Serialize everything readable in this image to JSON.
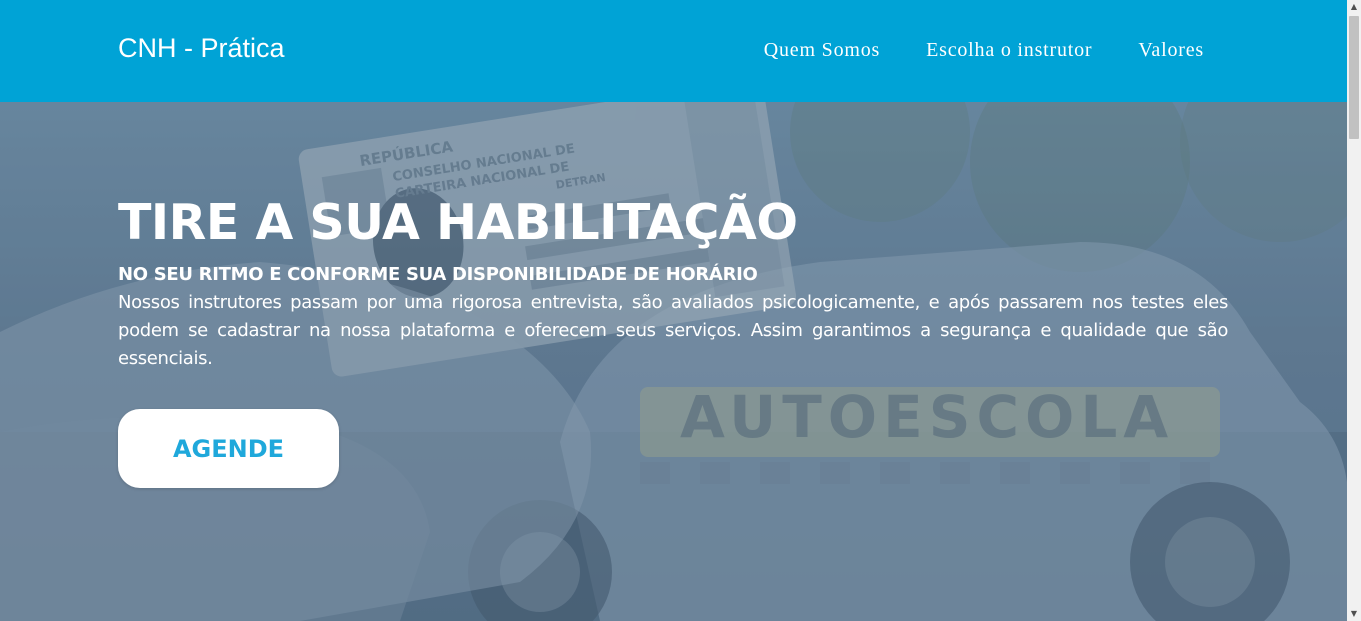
{
  "navbar": {
    "brand": "CNH - Prática",
    "links": [
      {
        "label": "Quem Somos"
      },
      {
        "label": "Escolha o instrutor"
      },
      {
        "label": "Valores"
      }
    ],
    "background": "#00a3d6"
  },
  "hero": {
    "title": "TIRE A SUA HABILITAÇÃO",
    "subtitle": "NO SEU RITMO E CONFORME SUA DISPONIBILIDADE DE HORÁRIO",
    "text": "Nossos instrutores passam por uma rigorosa entrevista, são avaliados psicologicamente, e após passarem nos testes eles podem se cadastrar na nossa plataforma e oferecem seus serviços. Assim garantimos a segurança e qualidade que são essenciais.",
    "cta_label": "AGENDE",
    "background_photo": {
      "license_card_text": [
        "REPÚBLICA",
        "CONSELHO NACIONAL DE",
        "CARTEIRA NACIONAL DE",
        "DETRAN"
      ],
      "car_text": "AUTOESCOLA"
    }
  },
  "icons": {
    "scroll_up": "▲",
    "scroll_down": "▼"
  }
}
